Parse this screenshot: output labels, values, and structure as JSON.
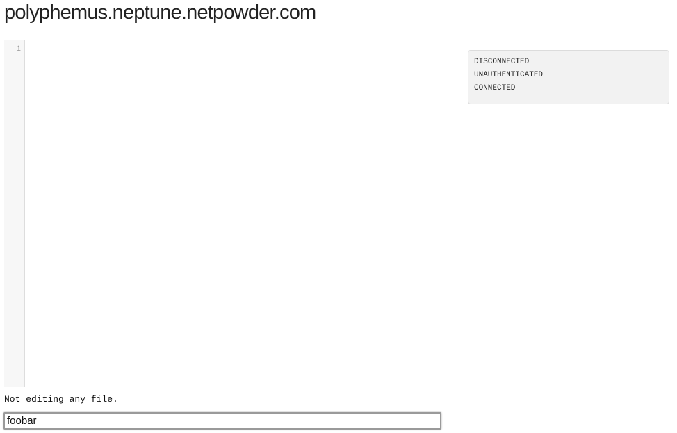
{
  "header": {
    "title": "polyphemus.neptune.netpowder.com"
  },
  "editor": {
    "line_numbers": [
      "1"
    ],
    "content": ""
  },
  "status_log": {
    "lines": [
      "DISCONNECTED",
      "UNAUTHENTICATED",
      "CONNECTED"
    ]
  },
  "footer": {
    "file_status": "Not editing any file.",
    "command_input": {
      "value": "foobar",
      "placeholder": ""
    }
  }
}
